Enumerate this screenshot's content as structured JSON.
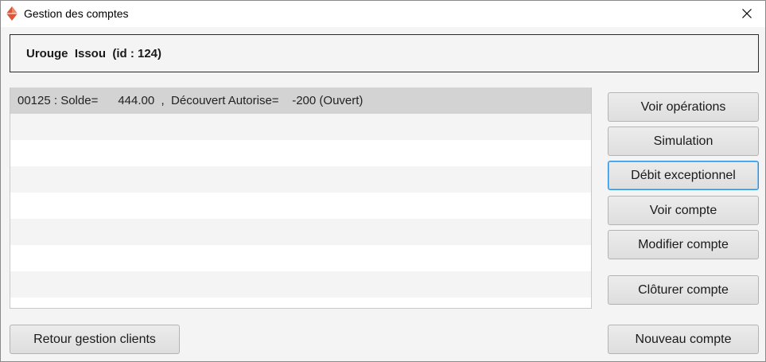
{
  "window": {
    "title": "Gestion des comptes",
    "close_symbol": "✕"
  },
  "header": {
    "client_text": "Urouge  Issou  (id : 124)"
  },
  "accounts": {
    "rows": [
      "00125 : Solde=      444.00  ,  Découvert Autorise=    -200 (Ouvert)",
      "",
      "",
      "",
      "",
      "",
      "",
      "",
      ""
    ],
    "selected_index": 0
  },
  "actions": {
    "voir_operations": "Voir opérations",
    "simulation": "Simulation",
    "debit_exceptionnel": "Débit exceptionnel",
    "voir_compte": "Voir compte",
    "modifier_compte": "Modifier compte",
    "cloturer_compte": "Clôturer compte",
    "nouveau_compte": "Nouveau compte",
    "retour_clients": "Retour gestion clients"
  },
  "colors": {
    "selected_row": "#d3d3d3",
    "focus_border": "#2a8fd6",
    "app_icon": "#d9573b"
  }
}
